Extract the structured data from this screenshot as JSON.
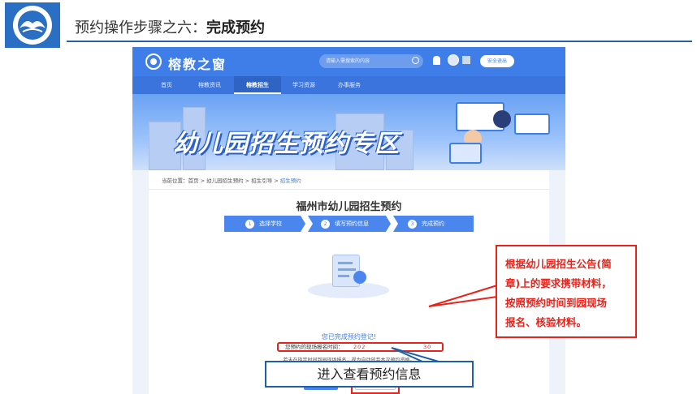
{
  "slide": {
    "title_prefix": "预约操作步骤之六：",
    "title_strong": "完成预约"
  },
  "site": {
    "name": "榕教之窗",
    "search_placeholder": "请输入需搜索的内容",
    "logout_label": "安全退出"
  },
  "nav": {
    "items": [
      "首页",
      "榕教资讯",
      "榕教招生",
      "学习资源",
      "办事服务"
    ],
    "active_index": 2
  },
  "banner": {
    "title": "幼儿园招生预约专区"
  },
  "breadcrumb": {
    "prefix": "当前位置：",
    "items": [
      "首页",
      "幼儿园招生预约",
      "招生引导"
    ],
    "current": "招生预约",
    "separator": " > "
  },
  "form": {
    "title": "福州市幼儿园招生预约",
    "steps": [
      {
        "num": "1",
        "label": "选择学校"
      },
      {
        "num": "2",
        "label": "填写预约信息"
      },
      {
        "num": "3",
        "label": "完成预约"
      }
    ],
    "done_message": "您已完成预约登记!",
    "time_label": "您预约的现场报名时间：",
    "time_value_start": "202",
    "time_value_end": "30",
    "notice": "若未在指定时间到园现场报名，视为自动放弃本次预约资格。",
    "done_button": "完成",
    "view_button": "查看预约信息"
  },
  "callouts": {
    "red_lines": [
      "根据幼儿园招生公告(简",
      "章)上的要求携带材料，",
      "按照预约时间到园现场",
      "报名、核验材料。"
    ],
    "blue": "进入查看预约信息"
  },
  "colors": {
    "primary": "#3f7de8",
    "highlight_red": "#e8231b",
    "callout_blue": "#1f5fa8"
  }
}
